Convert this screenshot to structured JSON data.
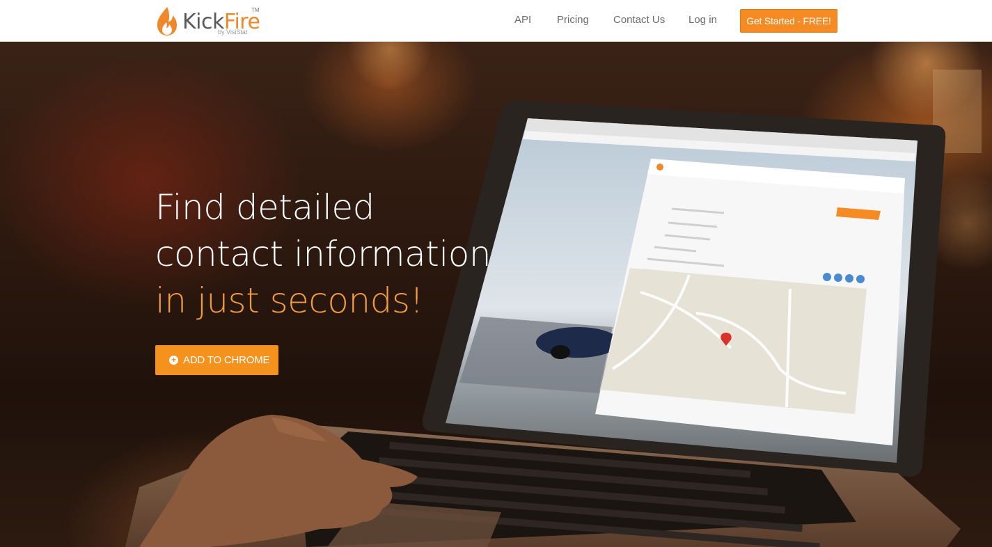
{
  "brand": {
    "name_part1": "Kick",
    "name_part2": "Fire",
    "trademark": "TM",
    "byline": "by VisiStat",
    "accent_color": "#f58b22"
  },
  "nav": {
    "items": [
      {
        "label": "API"
      },
      {
        "label": "Pricing"
      },
      {
        "label": "Contact Us"
      },
      {
        "label": "Log in"
      }
    ],
    "cta_label": "Get Started - FREE!"
  },
  "hero": {
    "headline_line1": "Find detailed",
    "headline_line2": "contact information",
    "headline_line3": "in just seconds!",
    "button_icon": "plus-circle-icon",
    "button_label": "ADD TO CHROME"
  }
}
